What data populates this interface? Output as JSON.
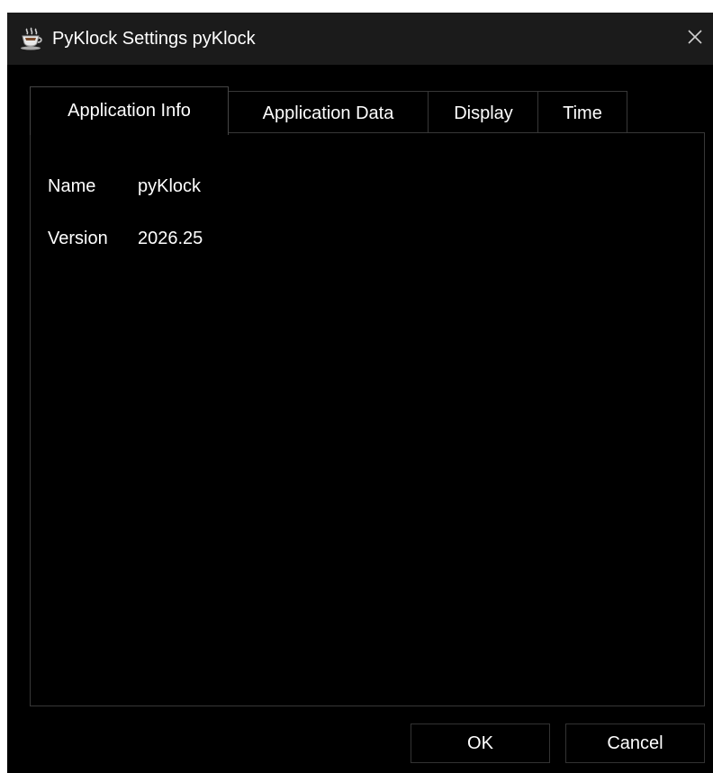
{
  "window": {
    "title": "PyKlock Settings pyKlock",
    "icon": "coffee-cup-icon",
    "close_icon": "close-icon"
  },
  "tabs": [
    {
      "label": "Application Info",
      "active": true
    },
    {
      "label": "Application Data",
      "active": false
    },
    {
      "label": "Display",
      "active": false
    },
    {
      "label": "Time",
      "active": false
    }
  ],
  "app_info": {
    "name_label": "Name",
    "name_value": "pyKlock",
    "version_label": "Version",
    "version_value": "2026.25"
  },
  "buttons": {
    "ok": "OK",
    "cancel": "Cancel"
  },
  "colors": {
    "background": "#000000",
    "titlebar": "#1b1b1b",
    "border": "#383838",
    "text": "#ffffff"
  }
}
